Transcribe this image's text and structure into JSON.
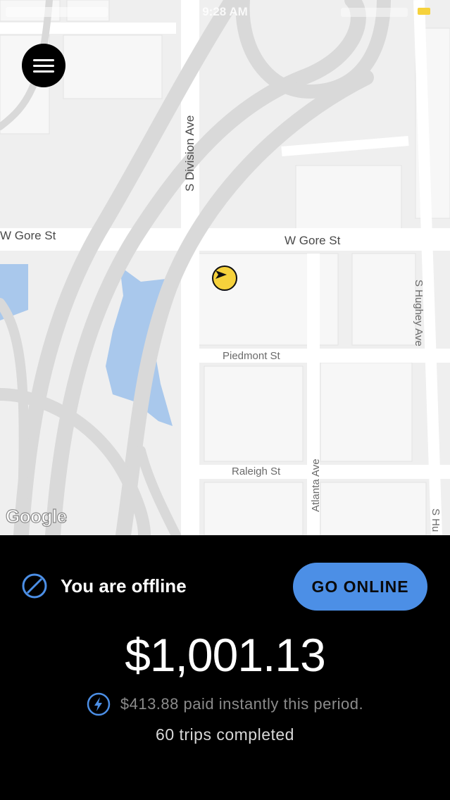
{
  "status_bar": {
    "time": "9:28 AM"
  },
  "map": {
    "streets": {
      "w_gore_left": "W Gore St",
      "w_gore_right": "W Gore St",
      "s_division": "S Division Ave",
      "piedmont": "Piedmont St",
      "raleigh": "Raleigh St",
      "atlanta": "Atlanta Ave",
      "s_hughey": "S Hughey Ave",
      "s_hu": "S Hu"
    },
    "attribution": "Google"
  },
  "panel": {
    "status_text": "You are offline",
    "go_online_label": "GO ONLINE",
    "earnings": "$1,001.13",
    "instant_pay_text": "$413.88 paid instantly this period.",
    "trips_text": "60 trips completed"
  },
  "colors": {
    "accent_blue": "#4c8fe6",
    "car_yellow": "#f6d23c",
    "panel_bg": "#000000",
    "map_bg": "#efefef",
    "water": "#a9c8ec",
    "road": "#d9d9d9"
  },
  "icons": {
    "menu": "hamburger-menu-icon",
    "offline": "no-entry-circle-icon",
    "instant_pay": "lightning-bolt-icon",
    "car": "navigation-arrow-icon"
  }
}
